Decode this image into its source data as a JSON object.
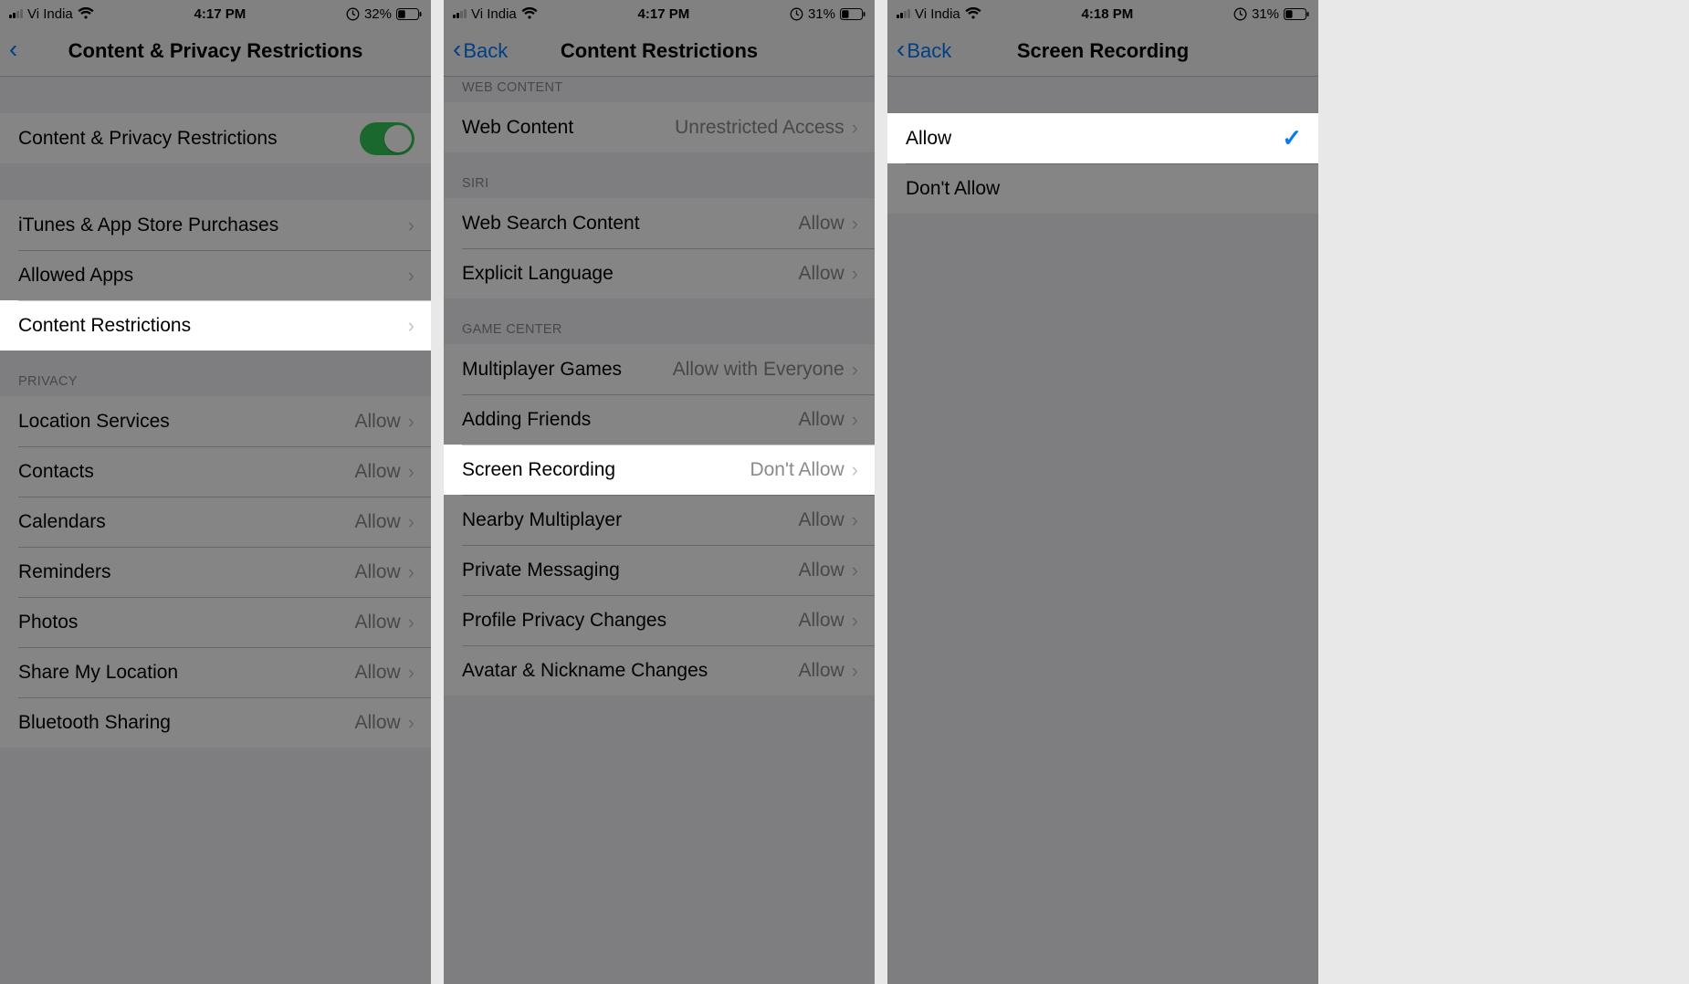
{
  "screen1": {
    "status": {
      "carrier": "Vi India",
      "time": "4:17 PM",
      "battery": "32%"
    },
    "nav": {
      "back": "",
      "title": "Content & Privacy Restrictions"
    },
    "toggleRow": {
      "label": "Content & Privacy Restrictions"
    },
    "rows_top": [
      {
        "label": "iTunes & App Store Purchases"
      },
      {
        "label": "Allowed Apps"
      }
    ],
    "highlighted": {
      "label": "Content Restrictions"
    },
    "privacy_header": "PRIVACY",
    "privacy_rows": [
      {
        "label": "Location Services",
        "value": "Allow"
      },
      {
        "label": "Contacts",
        "value": "Allow"
      },
      {
        "label": "Calendars",
        "value": "Allow"
      },
      {
        "label": "Reminders",
        "value": "Allow"
      },
      {
        "label": "Photos",
        "value": "Allow"
      },
      {
        "label": "Share My Location",
        "value": "Allow"
      },
      {
        "label": "Bluetooth Sharing",
        "value": "Allow"
      }
    ]
  },
  "screen2": {
    "status": {
      "carrier": "Vi India",
      "time": "4:17 PM",
      "battery": "31%"
    },
    "nav": {
      "back": "Back",
      "title": "Content Restrictions"
    },
    "web_header": "WEB CONTENT",
    "web_rows": [
      {
        "label": "Web Content",
        "value": "Unrestricted Access"
      }
    ],
    "siri_header": "SIRI",
    "siri_rows": [
      {
        "label": "Web Search Content",
        "value": "Allow"
      },
      {
        "label": "Explicit Language",
        "value": "Allow"
      }
    ],
    "gc_header": "GAME CENTER",
    "gc_rows_a": [
      {
        "label": "Multiplayer Games",
        "value": "Allow with Everyone"
      },
      {
        "label": "Adding Friends",
        "value": "Allow"
      }
    ],
    "highlighted": {
      "label": "Screen Recording",
      "value": "Don't Allow"
    },
    "gc_rows_b": [
      {
        "label": "Nearby Multiplayer",
        "value": "Allow"
      },
      {
        "label": "Private Messaging",
        "value": "Allow"
      },
      {
        "label": "Profile Privacy Changes",
        "value": "Allow"
      },
      {
        "label": "Avatar & Nickname Changes",
        "value": "Allow"
      }
    ]
  },
  "screen3": {
    "status": {
      "carrier": "Vi India",
      "time": "4:18 PM",
      "battery": "31%"
    },
    "nav": {
      "back": "Back",
      "title": "Screen Recording"
    },
    "highlighted": {
      "label": "Allow"
    },
    "other": {
      "label": "Don't Allow"
    }
  }
}
